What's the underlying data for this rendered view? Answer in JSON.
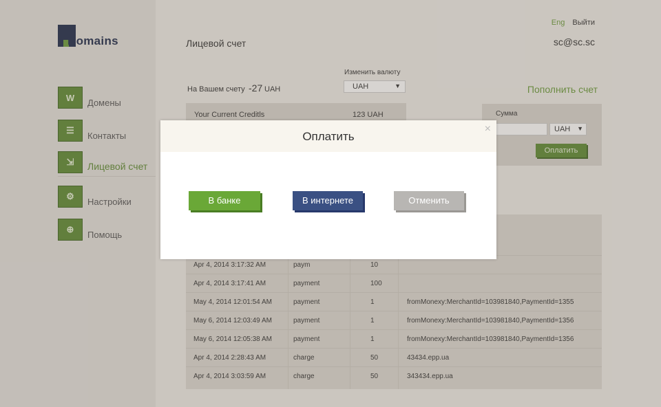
{
  "logo": {
    "text": "Domains"
  },
  "nav": [
    {
      "label": "Домены",
      "icon": "www-icon",
      "glyph": "W",
      "active": false
    },
    {
      "label": "Контакты",
      "icon": "contacts-list-icon",
      "glyph": "☰",
      "active": false
    },
    {
      "label": "Лицевой счет",
      "icon": "wallet-icon",
      "glyph": "⇲",
      "active": true
    },
    {
      "label": "Настройки",
      "icon": "gear-icon",
      "glyph": "⚙",
      "active": false
    },
    {
      "label": "Помощь",
      "icon": "lifebuoy-icon",
      "glyph": "⊕",
      "active": false
    }
  ],
  "header": {
    "lang": "Eng",
    "logout": "Выйти",
    "user_email": "sc@sc.sc"
  },
  "page": {
    "title": "Лицевой счет"
  },
  "balance": {
    "label": "На Вашем счету",
    "value": "-27",
    "currency": "UAH"
  },
  "currency_switch": {
    "label": "Изменить валюту",
    "selected": "UAH"
  },
  "topup": {
    "label": "Пополнить счет"
  },
  "credits": {
    "label": "Your Current Creditls",
    "value": "123 UAH"
  },
  "payment_form": {
    "amount_label": "Сумма",
    "amount_value": "",
    "currency": "UAH",
    "submit": "Оплатить"
  },
  "transactions": [
    {
      "date": "Apr 4, 2014 3:17:32 AM",
      "type": "paym",
      "amount": "10",
      "desc": ""
    },
    {
      "date": "Apr 4, 2014 3:17:41 AM",
      "type": "payment",
      "amount": "100",
      "desc": ""
    },
    {
      "date": "May 4, 2014 12:01:54 AM",
      "type": "payment",
      "amount": "1",
      "desc": "fromMonexy:MerchantId=103981840,PaymentId=1355"
    },
    {
      "date": "May 6, 2014 12:03:49 AM",
      "type": "payment",
      "amount": "1",
      "desc": "fromMonexy:MerchantId=103981840,PaymentId=1356"
    },
    {
      "date": "May 6, 2014 12:05:38 AM",
      "type": "payment",
      "amount": "1",
      "desc": "fromMonexy:MerchantId=103981840,PaymentId=1356"
    },
    {
      "date": "Apr 4, 2014 2:28:43 AM",
      "type": "charge",
      "amount": "50",
      "desc": "43434.epp.ua"
    },
    {
      "date": "Apr 4, 2014 3:03:59 AM",
      "type": "charge",
      "amount": "50",
      "desc": "343434.epp.ua"
    }
  ],
  "modal": {
    "title": "Оплатить",
    "close": "×",
    "bank_button": "В банке",
    "internet_button": "В интернете",
    "cancel_button": "Отменить"
  },
  "colors": {
    "accent": "#5e8a33",
    "bank": "#6aa837",
    "internet": "#3a5083",
    "cancel": "#b8b6b3"
  }
}
